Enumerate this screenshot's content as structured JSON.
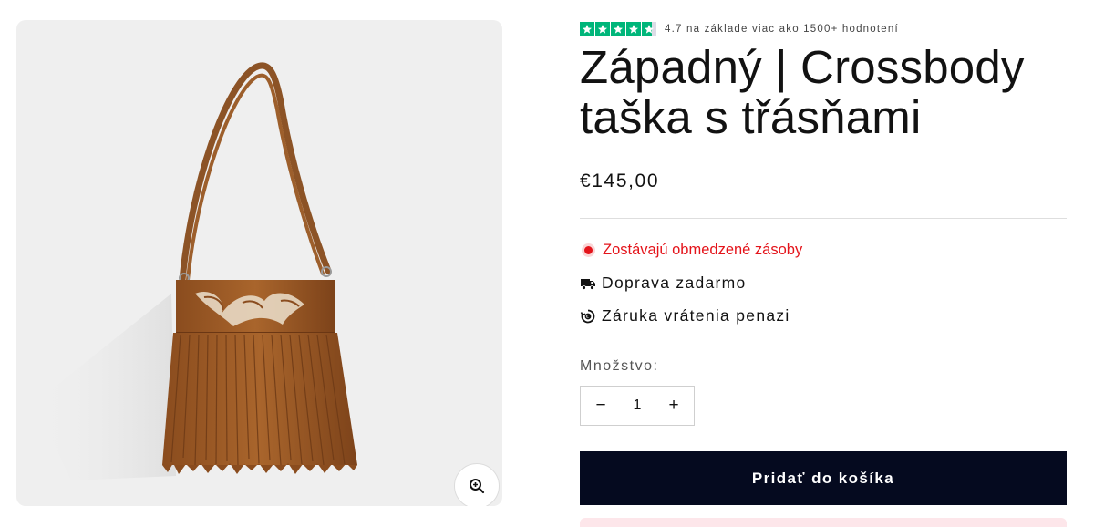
{
  "rating": {
    "stars_filled": 4.7,
    "star_color": "#00b67a",
    "text": "4.7 na základe viac ako 1500+ hodnotení"
  },
  "product": {
    "title": "Západný | Crossbody taška s třásňami",
    "price": "€145,00"
  },
  "features": {
    "stock": "Zostávajú obmedzené zásoby",
    "stock_color": "#e4141b",
    "shipping": "Doprava zadarmo",
    "shipping_icon": "truck-icon",
    "guarantee": "Záruka vrátenia penazi",
    "guarantee_icon": "money-back-icon"
  },
  "quantity": {
    "label": "Množstvo:",
    "value": "1",
    "minus": "−",
    "plus": "+"
  },
  "cart": {
    "add_label": "Pridať do košíka",
    "button_color": "#050a1f"
  },
  "gallery": {
    "zoom_icon": "zoom-in-icon"
  }
}
